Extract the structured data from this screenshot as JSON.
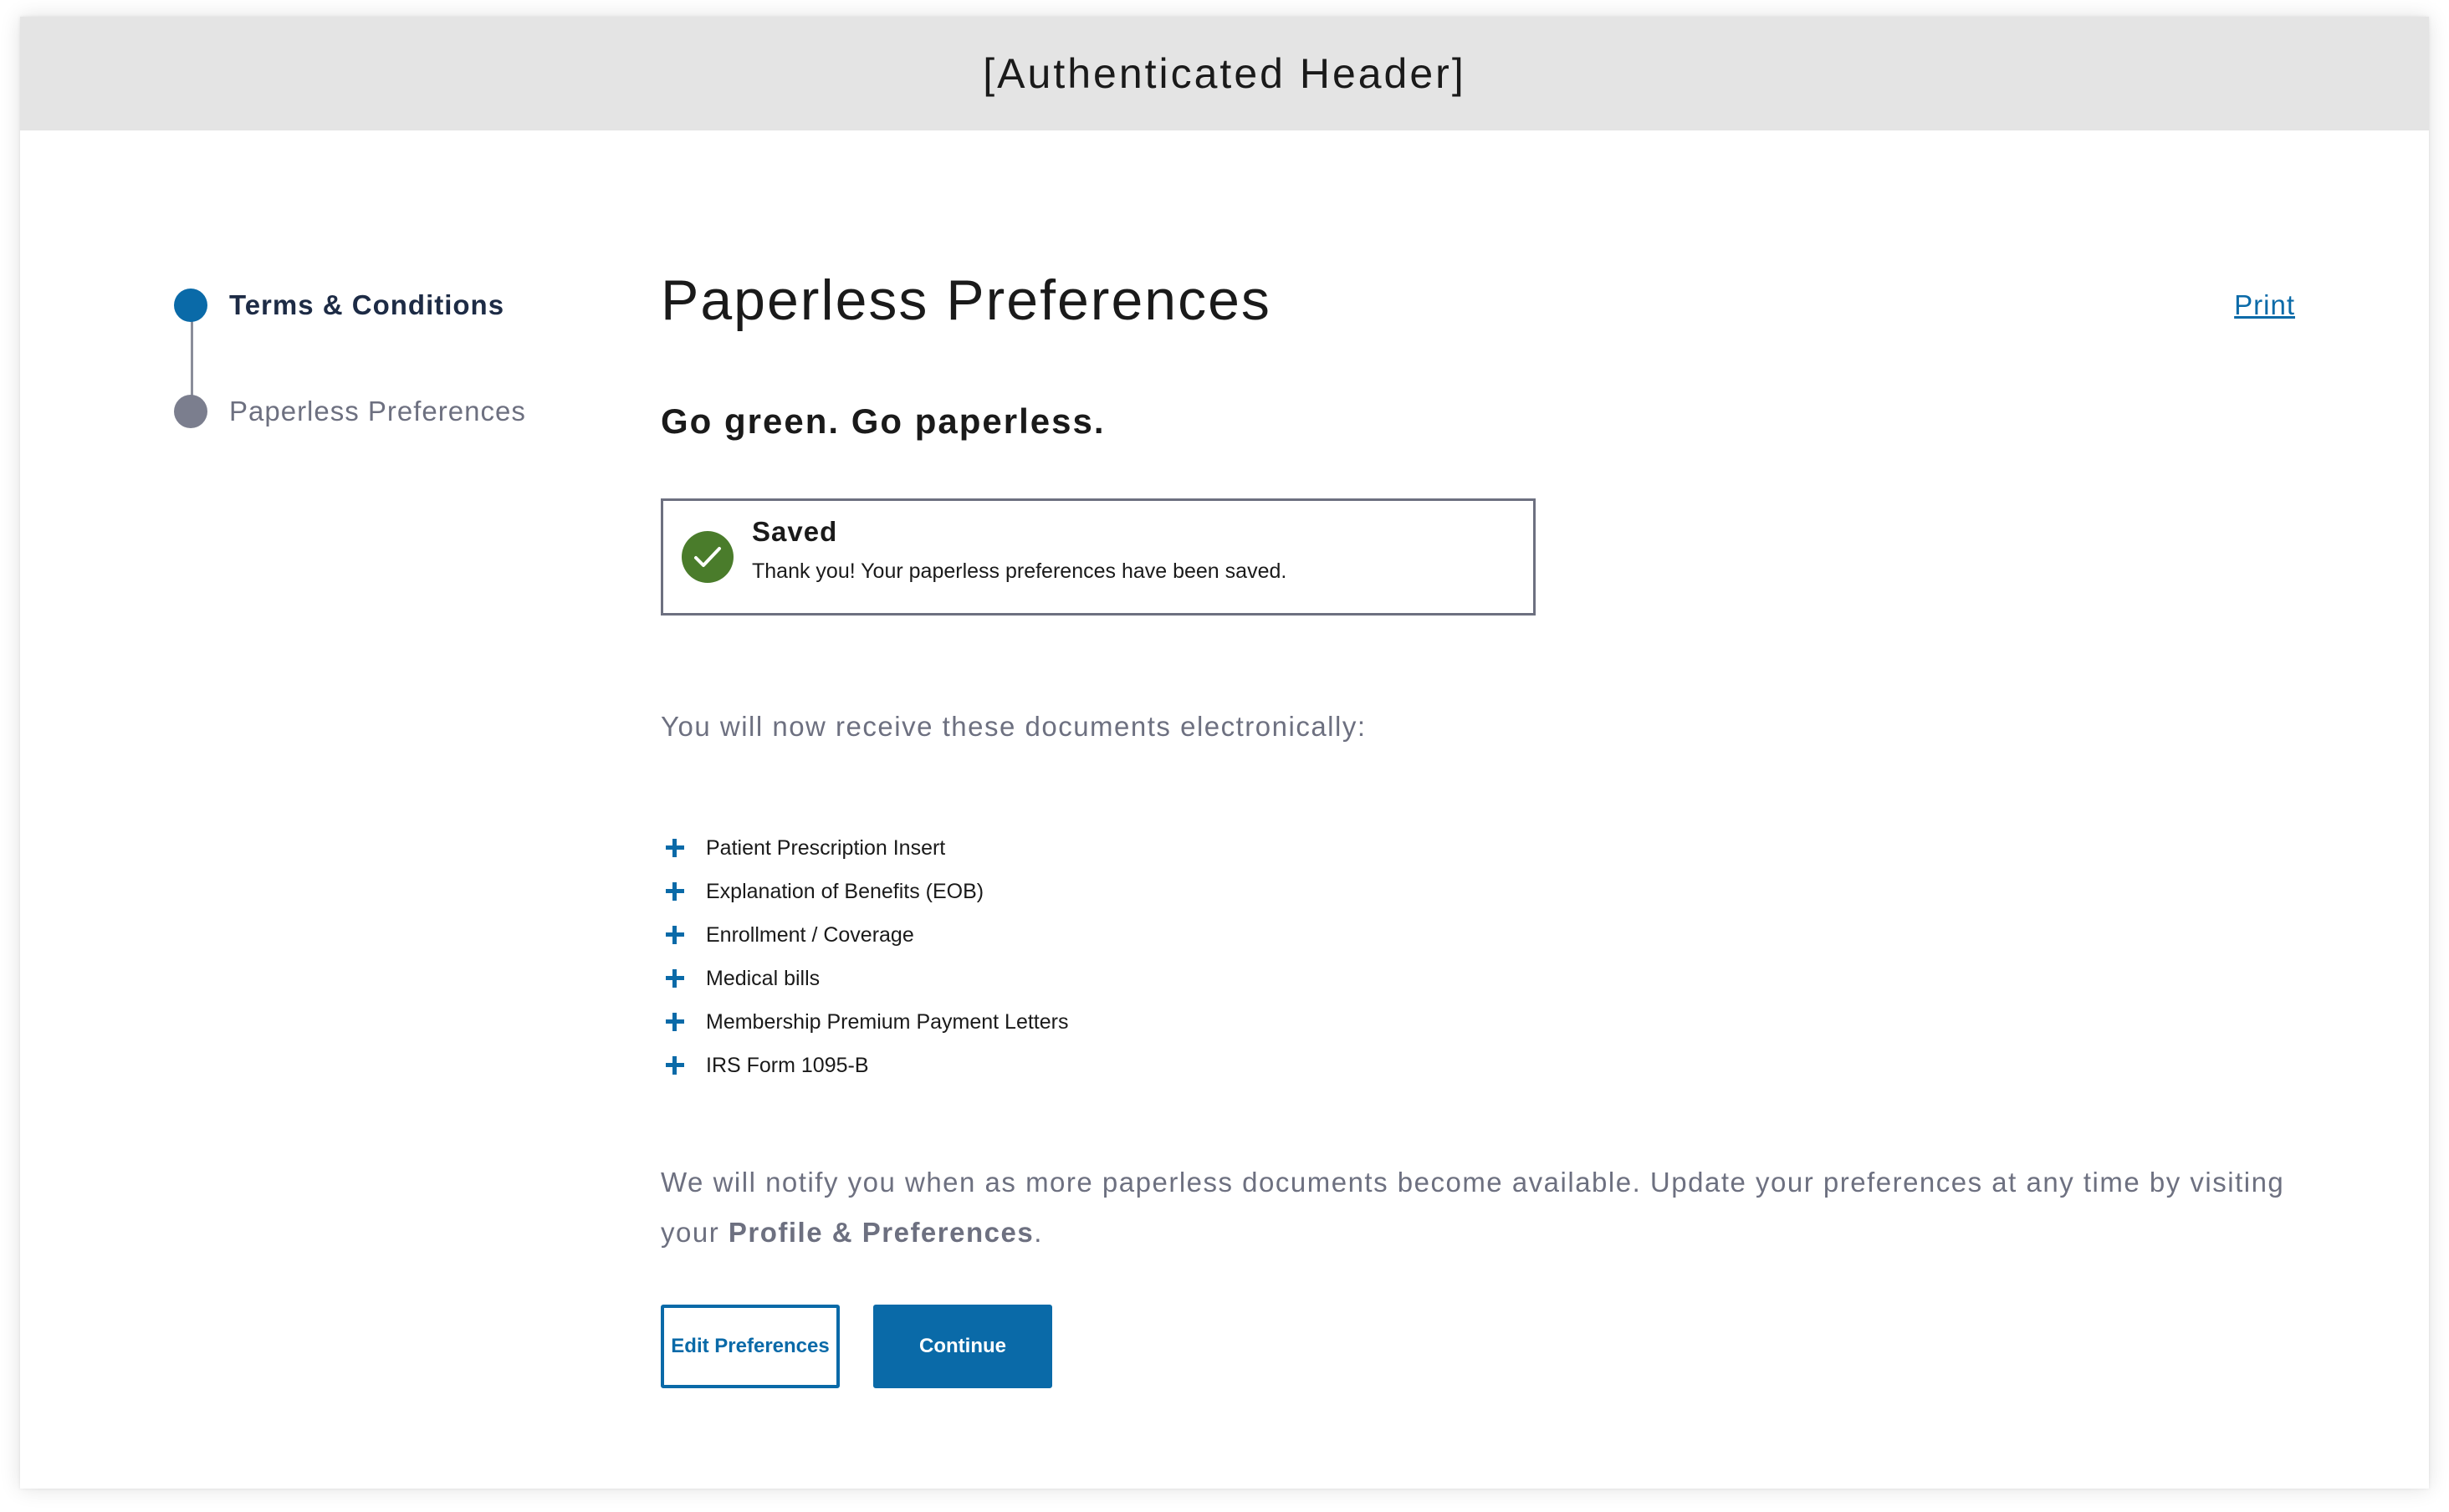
{
  "header": {
    "placeholder_text": "[Authenticated Header]"
  },
  "stepper": {
    "steps": [
      {
        "label": "Terms & Conditions",
        "state": "active"
      },
      {
        "label": "Paperless Preferences",
        "state": "inactive"
      }
    ]
  },
  "main": {
    "title": "Paperless Preferences",
    "print_label": "Print",
    "subtitle": "Go green. Go paperless.",
    "alert": {
      "icon": "check-circle-icon",
      "title": "Saved",
      "message": "Thank you! Your paperless preferences have been saved."
    },
    "intro": "You will now receive these documents electronically:",
    "documents": [
      "Patient Prescription Insert",
      "Explanation of Benefits (EOB)",
      "Enrollment / Coverage",
      "Medical bills",
      "Membership Premium Payment Letters",
      "IRS Form 1095-B"
    ],
    "notice_text": "We will notify you when as more paperless documents become available. Update your preferences at any time by visiting your ",
    "notice_link": "Profile & Preferences",
    "notice_end": ".",
    "buttons": {
      "edit_label": "Edit Preferences",
      "continue_label": "Continue"
    }
  },
  "colors": {
    "primary": "#0a6aa8",
    "success": "#4a7c2b",
    "muted_text": "#6d7080",
    "header_bg": "#e4e4e4"
  }
}
